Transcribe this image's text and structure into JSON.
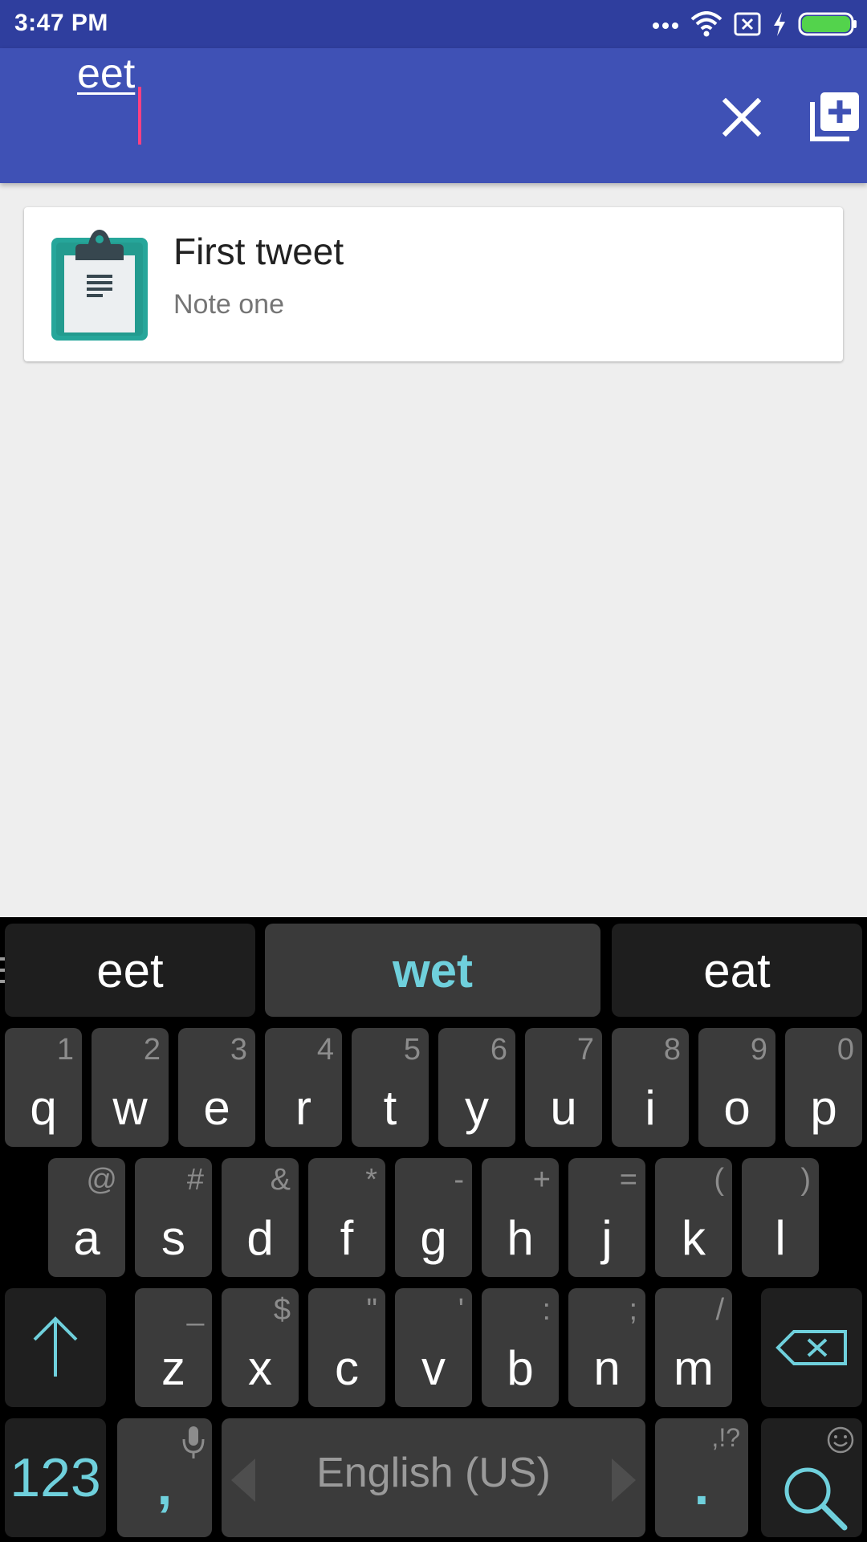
{
  "status_bar": {
    "time": "3:47 PM",
    "battery_color": "#53d34c"
  },
  "search": {
    "query": "eet"
  },
  "results": [
    {
      "title": "First tweet",
      "body": "Note one"
    }
  ],
  "keyboard": {
    "suggestions": [
      "eet",
      "wet",
      "eat"
    ],
    "row1": [
      {
        "key": "q",
        "hint": "1"
      },
      {
        "key": "w",
        "hint": "2"
      },
      {
        "key": "e",
        "hint": "3"
      },
      {
        "key": "r",
        "hint": "4"
      },
      {
        "key": "t",
        "hint": "5"
      },
      {
        "key": "y",
        "hint": "6"
      },
      {
        "key": "u",
        "hint": "7"
      },
      {
        "key": "i",
        "hint": "8"
      },
      {
        "key": "o",
        "hint": "9"
      },
      {
        "key": "p",
        "hint": "0"
      }
    ],
    "row2": [
      {
        "key": "a",
        "hint": "@"
      },
      {
        "key": "s",
        "hint": "#"
      },
      {
        "key": "d",
        "hint": "&"
      },
      {
        "key": "f",
        "hint": "*"
      },
      {
        "key": "g",
        "hint": "-"
      },
      {
        "key": "h",
        "hint": "+"
      },
      {
        "key": "j",
        "hint": "="
      },
      {
        "key": "k",
        "hint": "("
      },
      {
        "key": "l",
        "hint": ")"
      }
    ],
    "row3": [
      {
        "key": "z",
        "hint": "_"
      },
      {
        "key": "x",
        "hint": "$"
      },
      {
        "key": "c",
        "hint": "\""
      },
      {
        "key": "v",
        "hint": "'"
      },
      {
        "key": "b",
        "hint": ":"
      },
      {
        "key": "n",
        "hint": ";"
      },
      {
        "key": "m",
        "hint": "/"
      }
    ],
    "numbers_key": "123",
    "comma_key": ",",
    "space_label": "English (US)",
    "period_key": ".",
    "period_hint": ",!?",
    "accent_color": "#6fd0dc"
  }
}
